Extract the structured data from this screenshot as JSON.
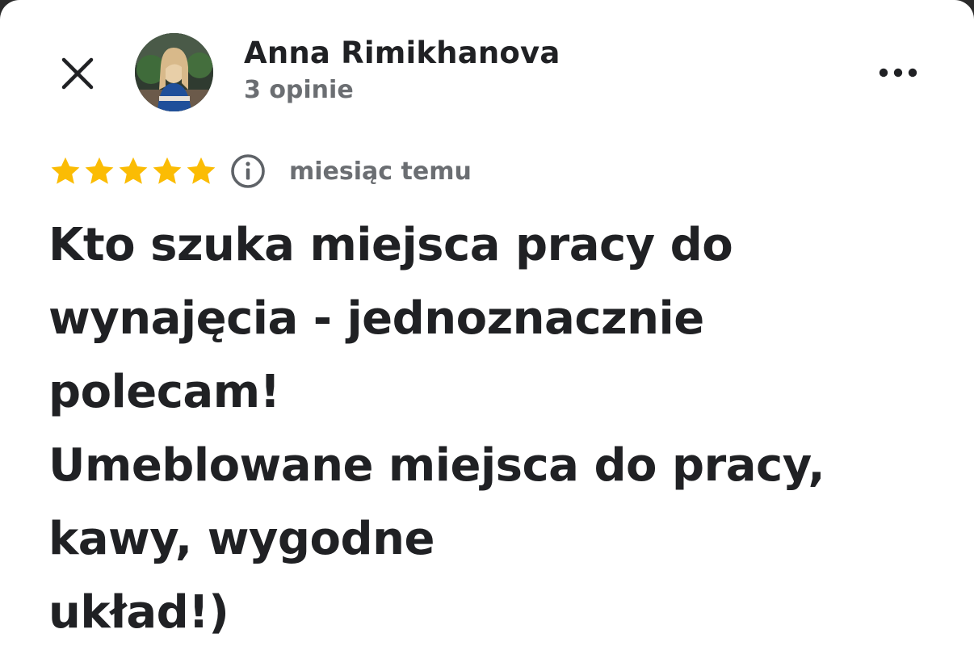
{
  "header": {
    "close_icon": "close-icon",
    "author_name": "Anna Rimikhanova",
    "author_meta": "3 opinie",
    "avatar_icon": "avatar-photo",
    "more_icon": "more-horizontal-icon"
  },
  "review": {
    "rating": 5,
    "rating_max": 5,
    "star_color": "#FBBC04",
    "info_icon": "info-icon",
    "date": "miesiąc temu",
    "lines": [
      "Kto szuka miejsca pracy do",
      "wynajęcia - jednoznacznie",
      "polecam!",
      "Umeblowane miejsca do pracy,",
      "kawy, wygodne",
      "układ!)"
    ]
  }
}
